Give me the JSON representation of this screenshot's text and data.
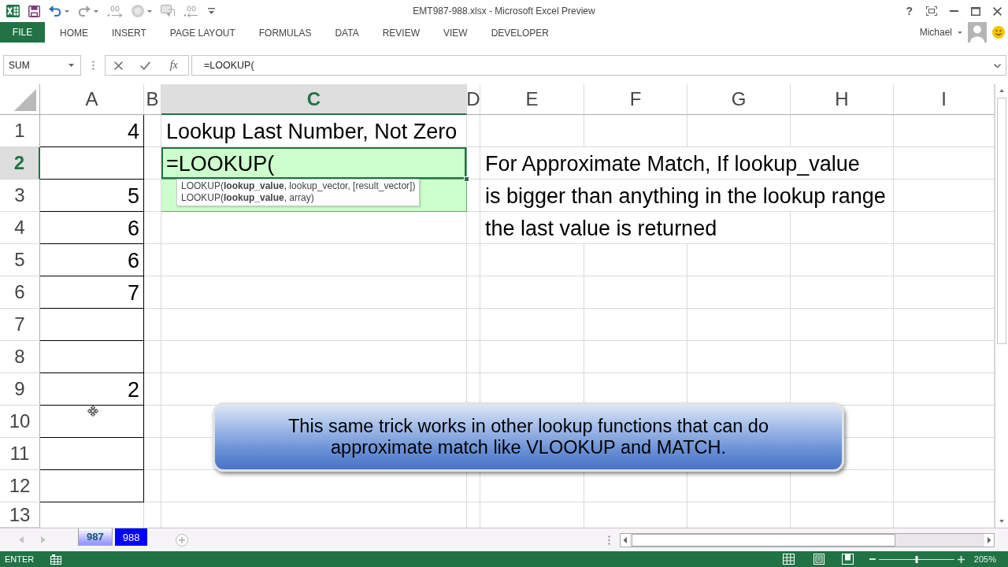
{
  "title_bar": {
    "title": "EMT987-988.xlsx - Microsoft Excel Preview",
    "help": "?"
  },
  "ribbon": {
    "tabs": [
      {
        "label": "FILE",
        "kind": "file",
        "selected": false
      },
      {
        "label": "HOME",
        "kind": "tab",
        "selected": false
      },
      {
        "label": "INSERT",
        "kind": "tab",
        "selected": false
      },
      {
        "label": "PAGE LAYOUT",
        "kind": "tab",
        "selected": false
      },
      {
        "label": "FORMULAS",
        "kind": "tab",
        "selected": false
      },
      {
        "label": "DATA",
        "kind": "tab",
        "selected": false
      },
      {
        "label": "REVIEW",
        "kind": "tab",
        "selected": false
      },
      {
        "label": "VIEW",
        "kind": "tab",
        "selected": false
      },
      {
        "label": "DEVELOPER",
        "kind": "tab",
        "selected": false
      }
    ],
    "user": "Michael"
  },
  "formula_bar": {
    "name_box": "SUM",
    "function_button": "fx",
    "formula": "=LOOKUP("
  },
  "sheet": {
    "columns": [
      {
        "label": "A",
        "selected": false
      },
      {
        "label": "B",
        "selected": false
      },
      {
        "label": "C",
        "selected": true
      },
      {
        "label": "D",
        "selected": false
      },
      {
        "label": "E",
        "selected": false
      },
      {
        "label": "F",
        "selected": false
      },
      {
        "label": "G",
        "selected": false
      },
      {
        "label": "H",
        "selected": false
      },
      {
        "label": "I",
        "selected": false
      }
    ],
    "rows": [
      {
        "label": "1",
        "selected": false,
        "a": {
          "value": "4",
          "kind": "number",
          "bordered": true
        },
        "c": {
          "value": "Lookup Last Number, Not Zero",
          "kind": "text"
        }
      },
      {
        "label": "2",
        "selected": true,
        "a": {
          "bordered": true
        },
        "c": {
          "value": "=LOOKUP(",
          "kind": "text",
          "active": true,
          "filled": true,
          "tooltip": [
            "LOOKUP(**lookup_value**, lookup_vector, [result_vector])",
            "LOOKUP(**lookup_value**, array)"
          ]
        },
        "e": {
          "value": "For Approximate Match, If lookup_value",
          "kind": "text"
        }
      },
      {
        "label": "3",
        "selected": false,
        "a": {
          "value": "5",
          "kind": "number",
          "bordered": true
        },
        "c": {
          "filled": true
        },
        "e": {
          "value": "is bigger than anything in the lookup range",
          "kind": "text"
        }
      },
      {
        "label": "4",
        "selected": false,
        "a": {
          "value": "6",
          "kind": "number",
          "bordered": true
        },
        "e": {
          "value": "the last value is returned",
          "kind": "text"
        }
      },
      {
        "label": "5",
        "selected": false,
        "a": {
          "value": "6",
          "kind": "number",
          "bordered": true
        }
      },
      {
        "label": "6",
        "selected": false,
        "a": {
          "value": "7",
          "kind": "number",
          "bordered": true
        }
      },
      {
        "label": "7",
        "selected": false,
        "a": {
          "bordered": true
        }
      },
      {
        "label": "8",
        "selected": false,
        "a": {
          "bordered": true
        }
      },
      {
        "label": "9",
        "selected": false,
        "a": {
          "value": "2",
          "kind": "number",
          "bordered": true
        }
      },
      {
        "label": "10",
        "selected": false,
        "a": {
          "bordered": true
        }
      },
      {
        "label": "11",
        "selected": false,
        "a": {
          "bordered": true
        }
      },
      {
        "label": "12",
        "selected": false,
        "a": {
          "bordered": true
        }
      },
      {
        "label": "13",
        "selected": false
      }
    ]
  },
  "callout": {
    "text": "This same trick works in other lookup functions that can do approximate match like VLOOKUP and MATCH."
  },
  "sheet_tabs": [
    {
      "label": "987",
      "selected": true,
      "color": "#9999ff"
    },
    {
      "label": "988",
      "selected": false,
      "color": "#0000ff"
    }
  ],
  "status_bar": {
    "mode": "ENTER",
    "zoom_slider": {
      "level": 0.5
    },
    "zoom": "205%"
  }
}
